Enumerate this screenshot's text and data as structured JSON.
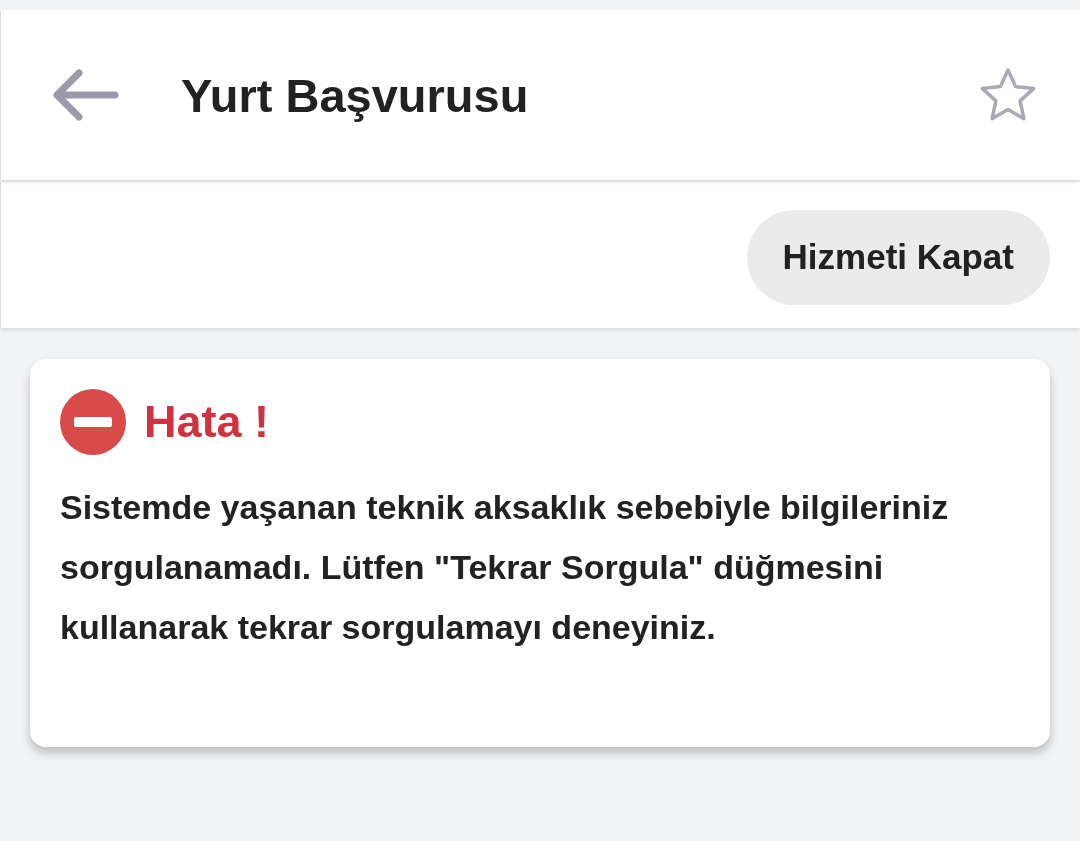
{
  "header": {
    "title": "Yurt Başvurusu",
    "favorite": false
  },
  "action_button": {
    "label": "Hizmeti Kapat"
  },
  "error": {
    "title": "Hata !",
    "message": "Sistemde yaşanan teknik aksaklık sebebiyle bilgileriniz sorgulanamadı. Lütfen \"Tekrar Sorgula\" düğmesini kullanarak tekrar sorgulamayı deneyiniz."
  }
}
